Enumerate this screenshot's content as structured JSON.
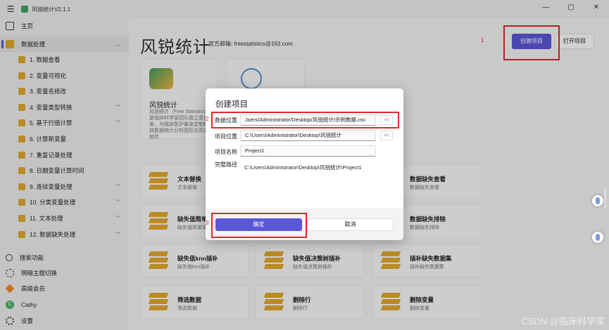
{
  "window": {
    "title": "风锐统计V2.1.1"
  },
  "sidebar": {
    "home": "主页",
    "data_processing": "数据处理",
    "items": [
      {
        "label": "1. 数据查看",
        "expand": false
      },
      {
        "label": "2. 变量可视化",
        "expand": false
      },
      {
        "label": "3. 变量名修改",
        "expand": false
      },
      {
        "label": "4. 变量类型转换",
        "expand": true
      },
      {
        "label": "5. 基于行值计算",
        "expand": true
      },
      {
        "label": "6. 计算新变量",
        "expand": false
      },
      {
        "label": "7. 重复记录处理",
        "expand": false
      },
      {
        "label": "8. 日期变量计算时间",
        "expand": false
      },
      {
        "label": "9. 连续变量处理",
        "expand": true
      },
      {
        "label": "10. 分类变量处理",
        "expand": true
      },
      {
        "label": "11. 文本处理",
        "expand": true
      },
      {
        "label": "12. 数据缺失处理",
        "expand": true
      }
    ],
    "bottom": {
      "search": "搜索功能",
      "theme": "明暗主题切换",
      "vip": "高级会员",
      "user": "Cathy",
      "settings": "设置"
    }
  },
  "main": {
    "app_title": "风锐统计",
    "email": "官方邮箱: freestatistics@163.com",
    "create_button": "创建项目",
    "open_button": "打开项目",
    "feature_card": {
      "name": "风锐统计",
      "desc": "风锐统计（Free Statistics）是临床科学家团队独立原创研发，为临床医护量身定制的高效数据统计分析图形化高质量软件"
    },
    "tiles": [
      {
        "name": "文本替换",
        "sub": "文本替换"
      },
      {
        "name": "数据缺失查看",
        "sub": "数据缺失查看"
      },
      {
        "name": "缺失值简单",
        "sub": "缺失值简单填补"
      },
      {
        "name": "数据缺失排除",
        "sub": "数据缺失排除"
      },
      {
        "name": "缺失值knn插补",
        "sub": "缺失值knn插补"
      },
      {
        "name": "缺失值决策树插补",
        "sub": "缺失值决策树插补"
      },
      {
        "name": "插补缺失数据集",
        "sub": "插补缺失数据集"
      },
      {
        "name": "筛选数据",
        "sub": "筛选数据"
      },
      {
        "name": "删除行",
        "sub": "删除行"
      },
      {
        "name": "删除变量",
        "sub": "删除变量"
      }
    ]
  },
  "dialog": {
    "title": "创建项目",
    "data_location_label": "数据位置",
    "data_location_value": "Jsers/Administrator/Desktop/风锐统计/示例数据.csv",
    "project_location_label": "项目位置",
    "project_location_value": "C:\\Users\\Administrator\\Desktop\\风锐统计",
    "project_name_label": "项目名称",
    "project_name_value": "Project1",
    "full_path_label": "完整路径",
    "full_path_value": "C:\\Users\\Administrator\\Desktop\\风锐统计\\Project1",
    "ok_button": "确定",
    "cancel_button": "取消"
  },
  "annotations": {
    "n1": "1",
    "n2": "2",
    "n3": "3"
  },
  "watermark": "CSDN @临床科学家",
  "colors": {
    "accent": "#5b57d9",
    "highlight": "#e0262b",
    "db_icon": "#e2a92e"
  }
}
